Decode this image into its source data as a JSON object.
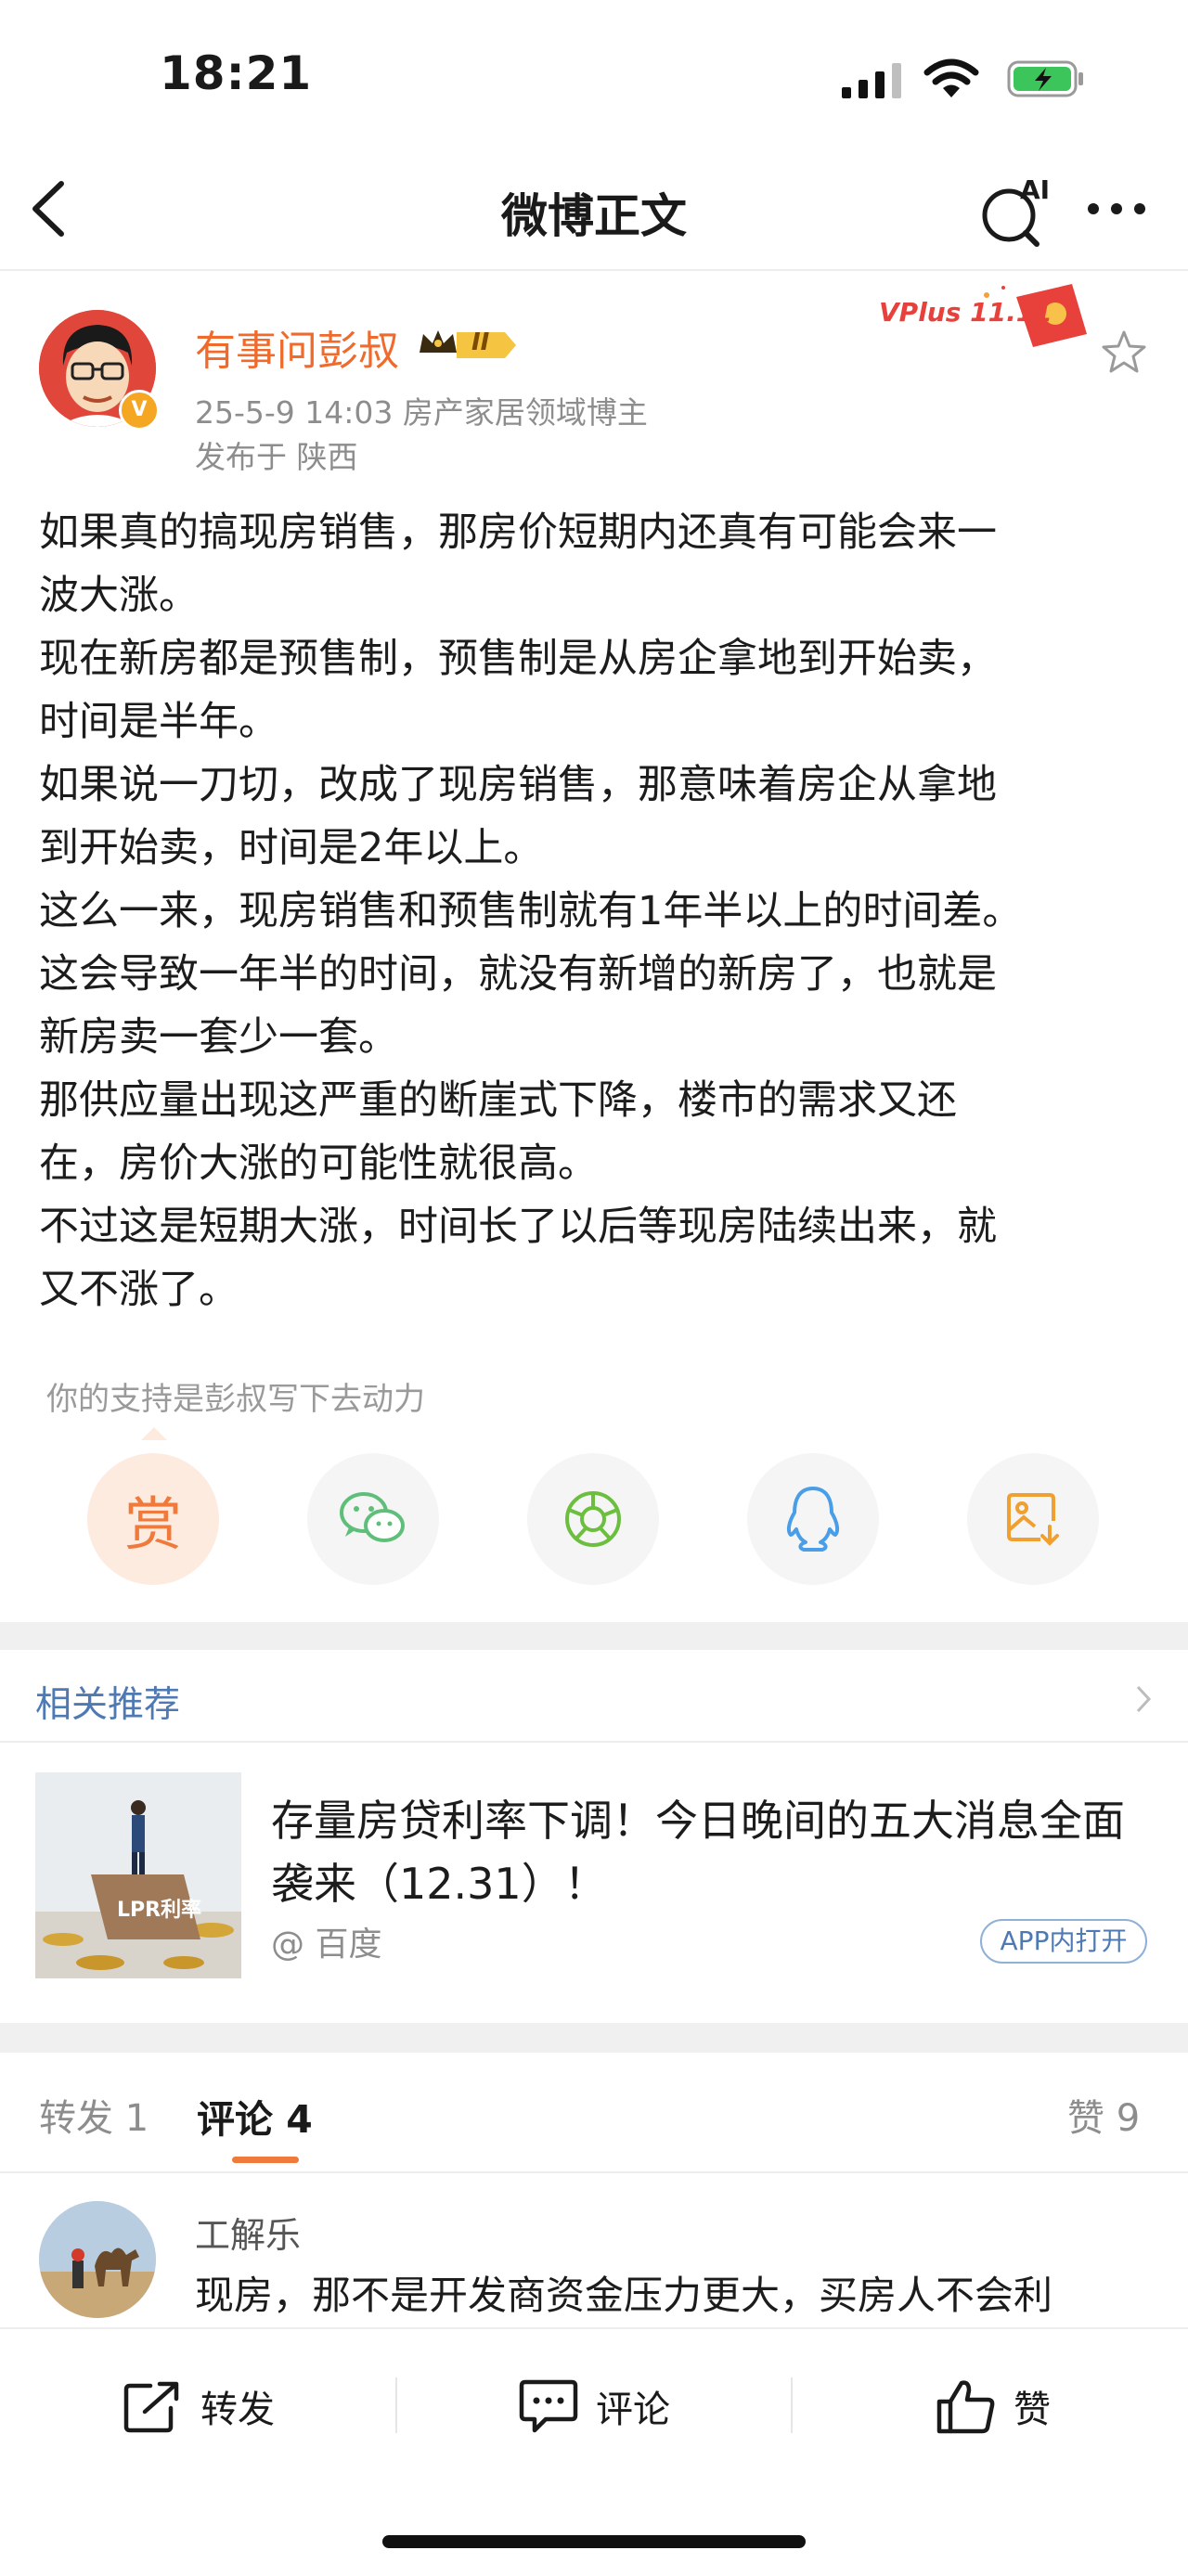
{
  "status_bar": {
    "time": "18:21"
  },
  "nav": {
    "title": "微博正文",
    "ai_label": "AI"
  },
  "author": {
    "name": "有事问彭叔",
    "badge_level": "II",
    "verified_mark": "V",
    "meta": "25-5-9 14:03  房产家居领域博主",
    "location": "发布于 陕西",
    "vplus_label": "VPlus 11.11"
  },
  "post": {
    "body": "如果真的搞现房销售，那房价短期内还真有可能会来一\n波大涨。\n现在新房都是预售制，预售制是从房企拿地到开始卖，\n时间是半年。\n如果说一刀切，改成了现房销售，那意味着房企从拿地\n到开始卖，时间是2年以上。\n这么一来，现房销售和预售制就有1年半以上的时间差。\n这会导致一年半的时间，就没有新增的新房了，也就是\n新房卖一套少一套。\n那供应量出现这严重的断崖式下降，楼市的需求又还\n在，房价大涨的可能性就很高。\n不过这是短期大涨，时间长了以后等现房陆续出来，就\n又不涨了。"
  },
  "support": {
    "text": "你的支持是彭叔写下去动力",
    "reward_label": "赏",
    "share_icons": [
      "reward-icon",
      "wechat-icon",
      "moments-icon",
      "qq-icon",
      "save-image-icon"
    ]
  },
  "related": {
    "title": "相关推荐",
    "item": {
      "thumb_text": "LPR利率",
      "title": "存量房贷利率下调！今日晚间的五大消息全面袭来（12.31）！",
      "source": "@ 百度",
      "app_open": "APP内打开"
    }
  },
  "tabs": {
    "repost": "转发 1",
    "comments": "评论 4",
    "likes": "赞 9"
  },
  "comment": {
    "user": "工解乐",
    "text": "现房，那不是开发商资金压力更大，买房人不会利"
  },
  "bottom_bar": {
    "repost": "转发",
    "comment": "评论",
    "like": "赞"
  },
  "colors": {
    "accent_orange": "#f07a3c",
    "link_blue": "#4e79b3",
    "wechat_green": "#5fbf7a",
    "qq_blue": "#4a9ee8",
    "save_orange": "#f0a030"
  }
}
